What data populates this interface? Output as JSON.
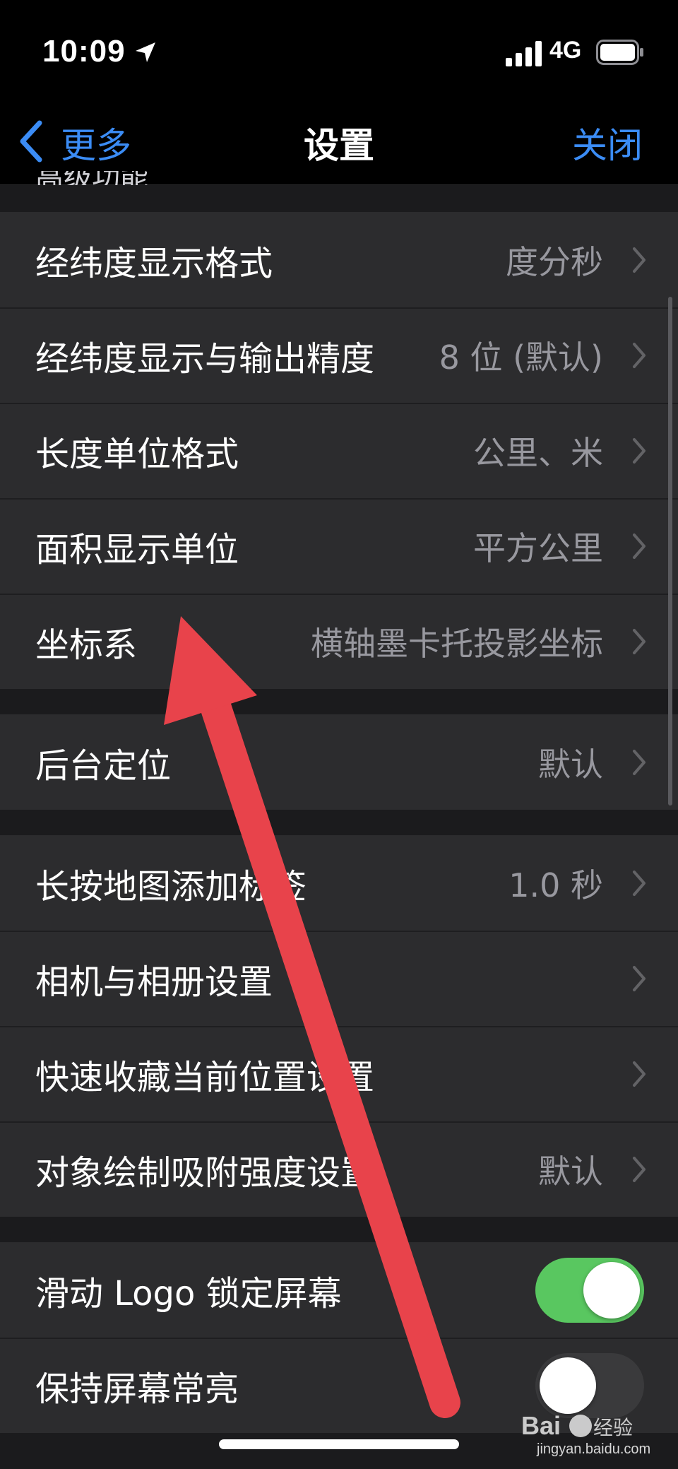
{
  "status_bar": {
    "time": "10:09",
    "network": "4G"
  },
  "nav": {
    "back_label": "更多",
    "title": "设置",
    "close_label": "关闭",
    "peek_text": "高级功能"
  },
  "groups": [
    {
      "rows": [
        {
          "label": "经纬度显示格式",
          "value": "度分秒"
        },
        {
          "label": "经纬度显示与输出精度",
          "value": "8 位 (默认)"
        },
        {
          "label": "长度单位格式",
          "value": "公里、米"
        },
        {
          "label": "面积显示单位",
          "value": "平方公里"
        },
        {
          "label": "坐标系",
          "value": "横轴墨卡托投影坐标"
        }
      ]
    },
    {
      "rows": [
        {
          "label": "后台定位",
          "value": "默认"
        }
      ]
    },
    {
      "rows": [
        {
          "label": "长按地图添加标签",
          "value": "1.0 秒"
        },
        {
          "label": "相机与相册设置",
          "value": ""
        },
        {
          "label": "快速收藏当前位置设置",
          "value": ""
        },
        {
          "label": "对象绘制吸附强度设置",
          "value": "默认"
        }
      ]
    },
    {
      "toggles": [
        {
          "label": "滑动 Logo 锁定屏幕",
          "state": "on"
        },
        {
          "label": "保持屏幕常亮",
          "state": "off"
        }
      ]
    }
  ],
  "colors": {
    "accent": "#3b8cf5",
    "toggle_on": "#59c760",
    "annotation_arrow": "#e8434b"
  },
  "watermark": {
    "brand": "Baidu 经验",
    "url": "jingyan.baidu.com"
  }
}
